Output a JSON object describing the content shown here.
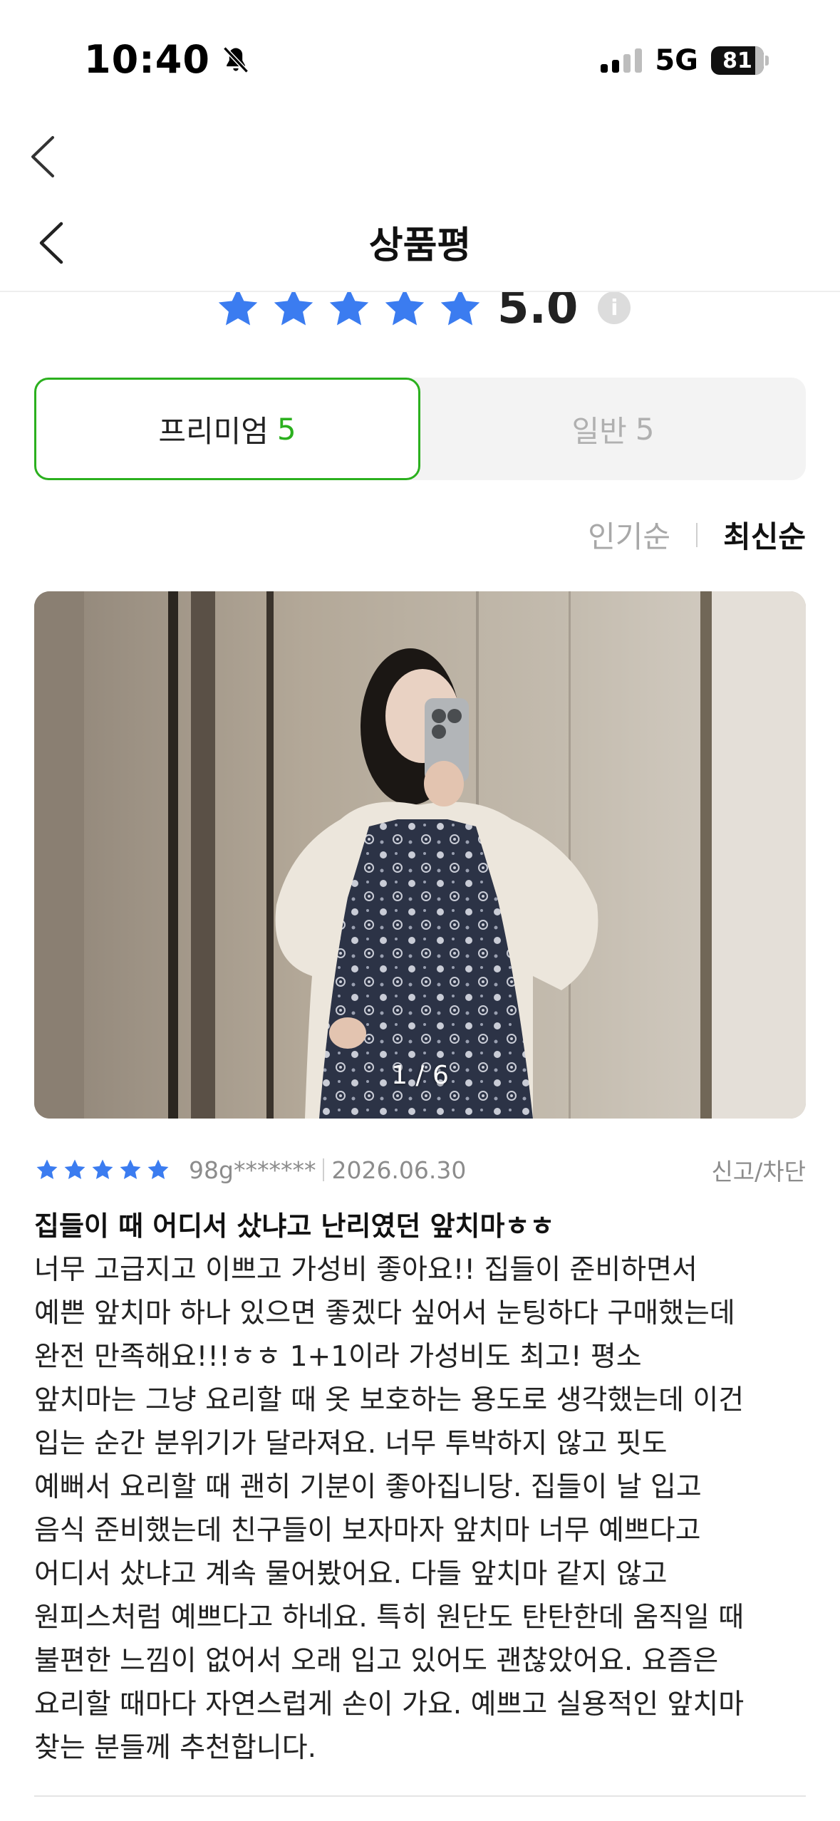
{
  "status_bar": {
    "time": "10:40",
    "network": "5G",
    "battery": "81"
  },
  "header": {
    "title": "상품평"
  },
  "rating": {
    "score": "5.0",
    "stars": 5,
    "info_icon": "i"
  },
  "tabs": [
    {
      "label": "프리미엄",
      "count": "5",
      "selected": true
    },
    {
      "label": "일반",
      "count": "5",
      "selected": false
    }
  ],
  "sort": {
    "popular": "인기순",
    "latest": "최신순"
  },
  "photo": {
    "counter": "1 / 6"
  },
  "review": {
    "stars": 5,
    "user": "98g*******",
    "date": "2026.06.30",
    "report": "신고/차단",
    "title": "집들이 때 어디서 샀냐고 난리였던 앞치마ㅎㅎ",
    "body": "너무 고급지고 이쁘고 가성비 좋아요!! 집들이 준비하면서 예쁜 앞치마 하나 있으면 좋겠다 싶어서 눈팅하다 구매했는데 완전 만족해요!!!ㅎㅎ 1+1이라 가성비도 최고! 평소 앞치마는 그냥 요리할 때 옷 보호하는 용도로 생각했는데 이건 입는 순간 분위기가 달라져요. 너무 투박하지 않고 핏도 예뻐서 요리할 때 괜히 기분이 좋아집니당. 집들이 날 입고 음식 준비했는데 친구들이 보자마자 앞치마 너무 예쁘다고 어디서 샀냐고 계속 물어봤어요. 다들 앞치마 같지 않고 원피스처럼 예쁘다고 하네요. 특히 원단도 탄탄한데 움직일 때 불편한 느낌이 없어서 오래 입고 있어도 괜찮았어요. 요즘은 요리할 때마다 자연스럽게 손이 가요. 예쁘고 실용적인 앞치마 찾는 분들께 추천합니다."
  },
  "colors": {
    "star": "#3b7cf0",
    "accent_green": "#2bb01e"
  }
}
